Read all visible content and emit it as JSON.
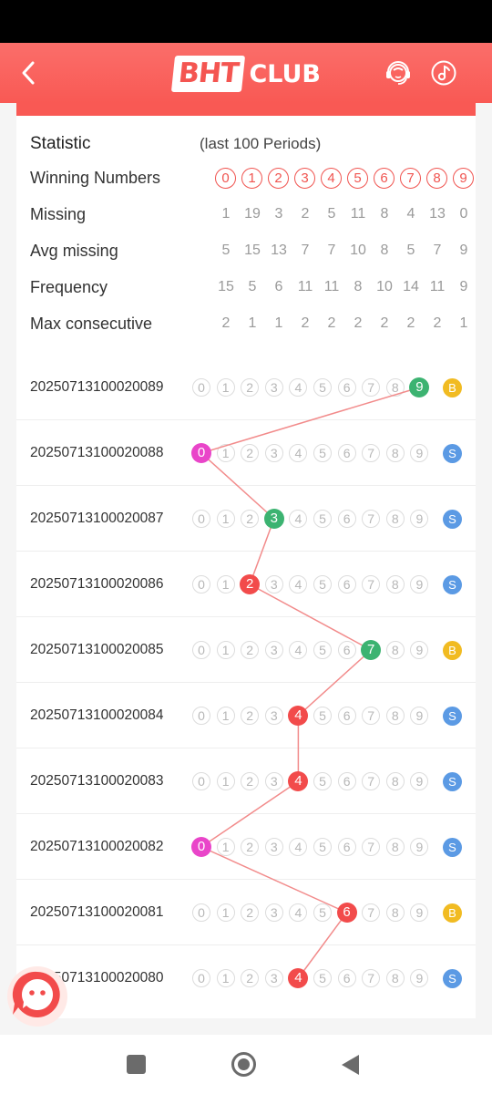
{
  "header": {
    "logo_text_boxed": "BHT",
    "logo_text": "CLUB",
    "background_color": "#f95954"
  },
  "icons": {
    "back": "chevron-left-icon",
    "support": "headset-icon",
    "music": "music-note-icon",
    "chat": "chat-bubble-icon"
  },
  "statistic": {
    "title": "Statistic",
    "subtitle": "(last 100 Periods)",
    "rows": [
      {
        "label": "Winning Numbers",
        "values": [
          "0",
          "1",
          "2",
          "3",
          "4",
          "5",
          "6",
          "7",
          "8",
          "9"
        ]
      },
      {
        "label": "Missing",
        "values": [
          "1",
          "19",
          "3",
          "2",
          "5",
          "11",
          "8",
          "4",
          "13",
          "0"
        ]
      },
      {
        "label": "Avg missing",
        "values": [
          "5",
          "15",
          "13",
          "7",
          "7",
          "10",
          "8",
          "5",
          "7",
          "9"
        ]
      },
      {
        "label": "Frequency",
        "values": [
          "15",
          "5",
          "6",
          "11",
          "11",
          "8",
          "10",
          "14",
          "11",
          "9"
        ]
      },
      {
        "label": "Max consecutive",
        "values": [
          "2",
          "1",
          "1",
          "2",
          "2",
          "2",
          "2",
          "2",
          "2",
          "1"
        ]
      }
    ]
  },
  "colors": {
    "red": "#f24b4b",
    "green": "#3cb371",
    "magenta": "#e945c9",
    "big": "#f1bb22",
    "small": "#5b9ae4",
    "trend_line": "#f28b8b"
  },
  "draws": [
    {
      "period": "20250713100020089",
      "number": 9,
      "color": "green",
      "size": "B"
    },
    {
      "period": "20250713100020088",
      "number": 0,
      "color": "magenta",
      "size": "S"
    },
    {
      "period": "20250713100020087",
      "number": 3,
      "color": "green",
      "size": "S"
    },
    {
      "period": "20250713100020086",
      "number": 2,
      "color": "red",
      "size": "S"
    },
    {
      "period": "20250713100020085",
      "number": 7,
      "color": "green",
      "size": "B"
    },
    {
      "period": "20250713100020084",
      "number": 4,
      "color": "red",
      "size": "S"
    },
    {
      "period": "20250713100020083",
      "number": 4,
      "color": "red",
      "size": "S"
    },
    {
      "period": "20250713100020082",
      "number": 0,
      "color": "magenta",
      "size": "S"
    },
    {
      "period": "20250713100020081",
      "number": 6,
      "color": "red",
      "size": "B"
    },
    {
      "period": "20250713100020080",
      "number": 4,
      "color": "red",
      "size": "S"
    }
  ]
}
